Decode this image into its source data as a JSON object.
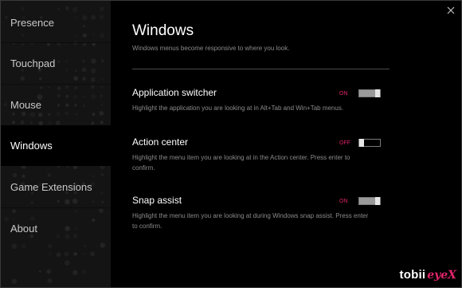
{
  "window": {
    "close_icon": "close-icon"
  },
  "sidebar": {
    "items": [
      {
        "label": "Presence",
        "active": false
      },
      {
        "label": "Touchpad",
        "active": false
      },
      {
        "label": "Mouse",
        "active": false
      },
      {
        "label": "Windows",
        "active": true
      },
      {
        "label": "Game Extensions",
        "active": false
      },
      {
        "label": "About",
        "active": false
      }
    ]
  },
  "main": {
    "title": "Windows",
    "subtitle": "Windows menus become responsive to where you look.",
    "settings": [
      {
        "title": "Application switcher",
        "description": "Highlight the application you are looking at in Alt+Tab and Win+Tab menus.",
        "state_label": "ON",
        "enabled": true
      },
      {
        "title": "Action center",
        "description": "Highlight the menu item you are looking at in the Action center. Press enter to confirm.",
        "state_label": "OFF",
        "enabled": false
      },
      {
        "title": "Snap assist",
        "description": "Highlight the menu item you are looking at during Windows snap assist. Press enter to confirm.",
        "state_label": "ON",
        "enabled": true
      }
    ]
  },
  "brand": {
    "name": "tobii",
    "product": "eyeX"
  },
  "colors": {
    "accent": "#e0246a",
    "background": "#000000",
    "sidebar": "#141414"
  }
}
